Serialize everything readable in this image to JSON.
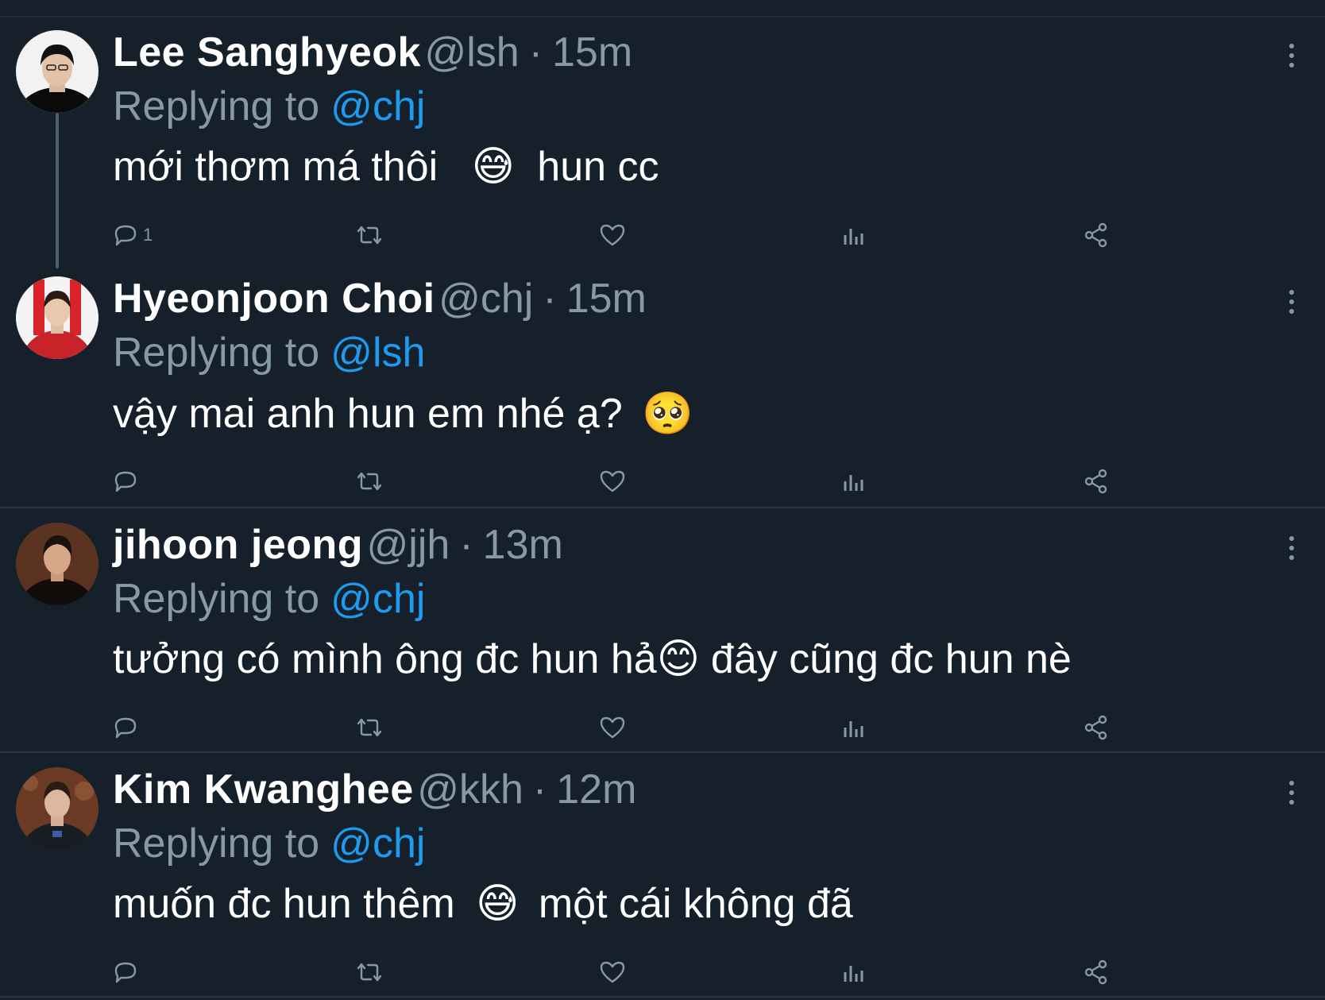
{
  "tweets": [
    {
      "name": "Lee Sanghyeok",
      "handle": "@lsh",
      "separator": "·",
      "time": "15m",
      "replying_prefix": "Replying to",
      "replying_to": "@chj",
      "text_before_emoji": "mới thơm má thôi",
      "emoji": "😅",
      "text_after_emoji": "hun cc",
      "reply_count": "1",
      "avatar": "black-outfit-portrait"
    },
    {
      "name": "Hyeonjoon Choi",
      "handle": "@chj",
      "separator": "·",
      "time": "15m",
      "replying_prefix": "Replying to",
      "replying_to": "@lsh",
      "text_before_emoji": "vậy mai anh hun em nhé ạ?",
      "emoji": "🥺",
      "text_after_emoji": "",
      "reply_count": "",
      "avatar": "red-jersey-portrait"
    },
    {
      "name": "jihoon jeong",
      "handle": "@jjh",
      "separator": "·",
      "time": "13m",
      "replying_prefix": "Replying to",
      "replying_to": "@chj",
      "text_before_emoji": "tưởng có mình ông đc hun hả",
      "emoji": "😊",
      "text_after_emoji": "đây cũng đc hun nè",
      "reply_count": "",
      "avatar": "dark-portrait-brown-background"
    },
    {
      "name": "Kim Kwanghee",
      "handle": "@kkh",
      "separator": "·",
      "time": "12m",
      "replying_prefix": "Replying to",
      "replying_to": "@chj",
      "text_before_emoji": "muốn đc hun thêm",
      "emoji": "😅",
      "text_after_emoji": "một cái không đã",
      "reply_count": "",
      "avatar": "suit-portrait-ornate-background"
    }
  ],
  "icons": {
    "reply": "reply-icon",
    "retweet": "retweet-icon",
    "like": "like-icon",
    "views": "views-icon",
    "share": "share-icon",
    "more": "more-icon"
  },
  "colors": {
    "background": "#15202b",
    "name": "#ffffff",
    "muted": "#8899a6",
    "mention": "#1d9bf0",
    "divider": "#2a3744"
  }
}
